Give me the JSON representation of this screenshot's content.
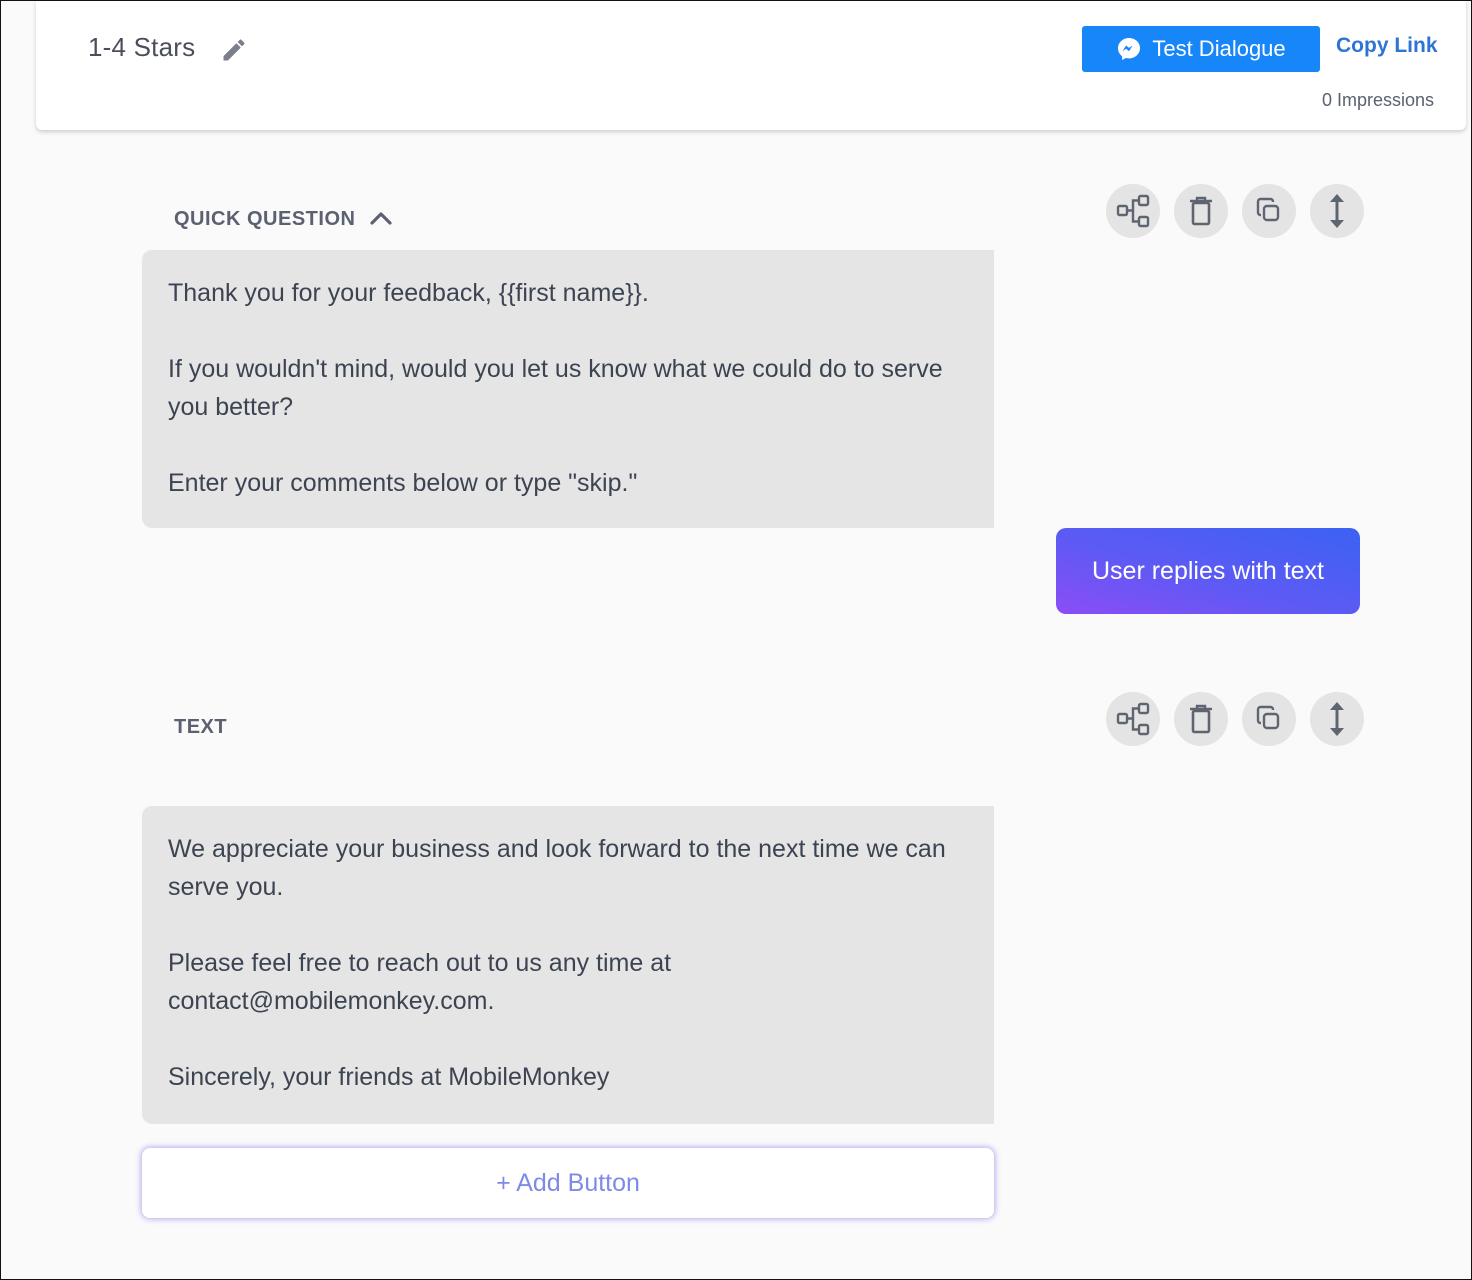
{
  "header": {
    "title": "1-4 Stars",
    "test_button_label": "Test Dialogue",
    "copy_link_label": "Copy Link",
    "impressions": "0 Impressions",
    "accent_color": "#1786f8"
  },
  "blocks": [
    {
      "label": "QUICK QUESTION",
      "lines": [
        "Thank you for your feedback, {{first name}}.",
        "If you wouldn't mind, would you let us know what we could do to serve you better?",
        "Enter your comments below or type \"skip.\""
      ],
      "reply_label": "User replies with text",
      "action_icons": [
        "flow-icon",
        "trash-icon",
        "copy-icon",
        "move-vertical-icon"
      ]
    },
    {
      "label": "TEXT",
      "lines": [
        "We appreciate your business and look forward to the next time we can serve you.",
        "Please feel free to reach out to us any time at contact@mobilemonkey.com.",
        "Sincerely, your friends at MobileMonkey"
      ],
      "add_button_label": "+ Add Button",
      "action_icons": [
        "flow-icon",
        "trash-icon",
        "copy-icon",
        "move-vertical-icon"
      ]
    }
  ]
}
